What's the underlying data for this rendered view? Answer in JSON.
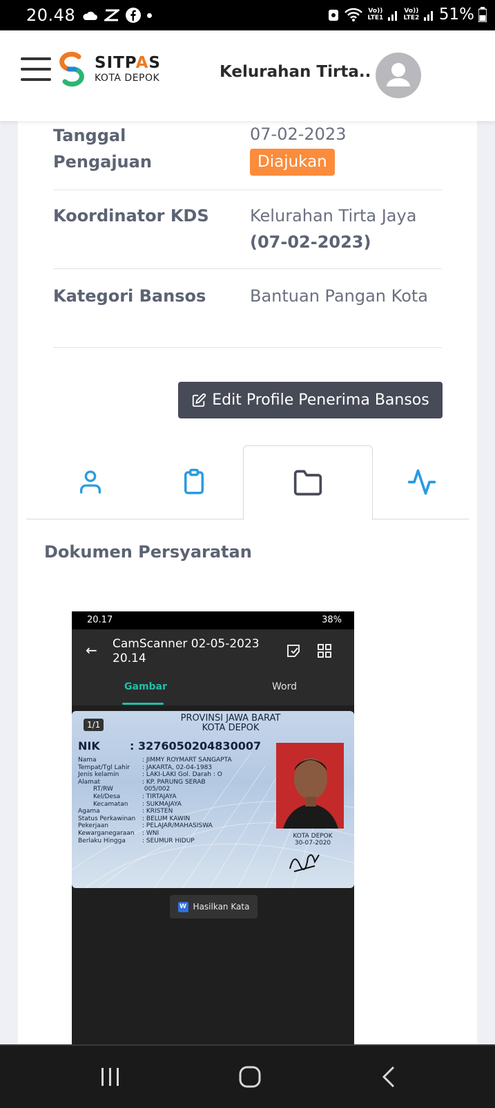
{
  "status_bar": {
    "time": "20.48",
    "battery": "51%",
    "sim1": "Vo)) LTE1",
    "sim2": "Vo)) LTE2"
  },
  "header": {
    "brand_name_part1": "SITP",
    "brand_name_accent": "A",
    "brand_name_part2": "S",
    "brand_sub": "KOTA DEPOK",
    "title": "Kelurahan Tirta..",
    "brand_colors": [
      "#ef7a22",
      "#2bb673",
      "#1e88d9"
    ]
  },
  "details": {
    "rows": [
      {
        "label": "Tanggal Pengajuan",
        "value": "07-02-2023",
        "badge": "Diajukan"
      },
      {
        "label": "Koordinator KDS",
        "value": "Kelurahan Tirta Jaya",
        "value_bold": "(07-02-2023)"
      },
      {
        "label": "Kategori Bansos",
        "value": "Bantuan Pangan Kota"
      }
    ],
    "badge_color": "#fb8c3c"
  },
  "actions": {
    "edit_profile": "Edit Profile Penerima Bansos"
  },
  "tabs": [
    {
      "icon": "user-icon",
      "active": false
    },
    {
      "icon": "clipboard-icon",
      "active": false
    },
    {
      "icon": "folder-icon",
      "active": true
    },
    {
      "icon": "activity-icon",
      "active": false
    }
  ],
  "section": {
    "title": "Dokumen Persyaratan"
  },
  "document_image": {
    "status_time": "20.17",
    "status_battery": "38%",
    "app_title": "CamScanner 02-05-2023 20.14",
    "tab_image": "Gambar",
    "tab_word": "Word",
    "page_indicator": "1/1",
    "province": "PROVINSI JAWA BARAT",
    "city": "KOTA DEPOK",
    "nik_label": "NIK",
    "nik_value": ": 3276050204830007",
    "fields": [
      {
        "k": "Nama",
        "v": ": JIMMY ROYMART SANGAPTA"
      },
      {
        "k": "Tempat/Tgl Lahir",
        "v": ": JAKARTA, 02-04-1983"
      },
      {
        "k": "Jenis kelamin",
        "v": ": LAKI-LAKI        Gol. Darah : O"
      },
      {
        "k": "Alamat",
        "v": ": KP. PARUNG SERAB"
      },
      {
        "k": "    RT/RW",
        "v": "  005/002"
      },
      {
        "k": "    Kel/Desa",
        "v": ": TIRTAJAYA"
      },
      {
        "k": "    Kecamatan",
        "v": ": SUKMAJAYA"
      },
      {
        "k": "Agama",
        "v": ": KRISTEN"
      },
      {
        "k": "Status Perkawinan",
        "v": ": BELUM KAWIN"
      },
      {
        "k": "Pekerjaan",
        "v": ": PELAJAR/MAHASISWA"
      },
      {
        "k": "Kewarganegaraan",
        "v": ": WNI"
      },
      {
        "k": "Berlaku Hingga",
        "v": ": SEUMUR HIDUP"
      }
    ],
    "issue_place": "KOTA DEPOK",
    "issue_date": "30-07-2020",
    "generate_button": "Hasilkan Kata"
  }
}
